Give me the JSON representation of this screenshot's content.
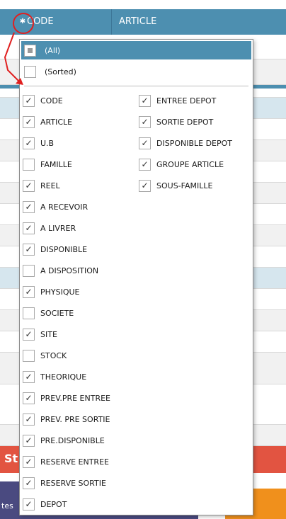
{
  "grid": {
    "header": {
      "code_label": "CODE",
      "article_label": "ARTICLE",
      "menu_icon": "asterisk-icon"
    },
    "red_bar_text": "St",
    "purple_bar_text": "tes"
  },
  "popup": {
    "all_label": "(All)",
    "sorted_label": "(Sorted)",
    "left_items": [
      {
        "label": "CODE",
        "checked": true
      },
      {
        "label": "ARTICLE",
        "checked": true
      },
      {
        "label": "U.B",
        "checked": true
      },
      {
        "label": "FAMILLE",
        "checked": false
      },
      {
        "label": "REEL",
        "checked": true
      },
      {
        "label": "A RECEVOIR",
        "checked": true
      },
      {
        "label": "A LIVRER",
        "checked": true
      },
      {
        "label": "DISPONIBLE",
        "checked": true
      },
      {
        "label": "A DISPOSITION",
        "checked": false
      },
      {
        "label": "PHYSIQUE",
        "checked": true
      },
      {
        "label": "SOCIETE",
        "checked": false
      },
      {
        "label": "SITE",
        "checked": true
      },
      {
        "label": "STOCK",
        "checked": false
      },
      {
        "label": "THEORIQUE",
        "checked": true
      },
      {
        "label": "PREV.PRE ENTREE",
        "checked": true
      },
      {
        "label": "PREV. PRE SORTIE",
        "checked": true
      },
      {
        "label": "PRE.DISPONIBLE",
        "checked": true
      },
      {
        "label": "RESERVE ENTREE",
        "checked": true
      },
      {
        "label": "RESERVE SORTIE",
        "checked": true
      },
      {
        "label": "DEPOT",
        "checked": true
      }
    ],
    "right_items": [
      {
        "label": "ENTREE DEPOT",
        "checked": true
      },
      {
        "label": "SORTIE DEPOT",
        "checked": true
      },
      {
        "label": "DISPONIBLE DEPOT",
        "checked": true
      },
      {
        "label": "GROUPE ARTICLE",
        "checked": true
      },
      {
        "label": "SOUS-FAMILLE",
        "checked": true
      }
    ],
    "check_glyph": "✓"
  },
  "colors": {
    "header": "#4d8fb0",
    "selected_item": "#4d8fb0",
    "annotation": "#e02020",
    "red_bar": "#e25441",
    "purple_bar": "#4a4a80",
    "orange_bar": "#f0901c"
  }
}
